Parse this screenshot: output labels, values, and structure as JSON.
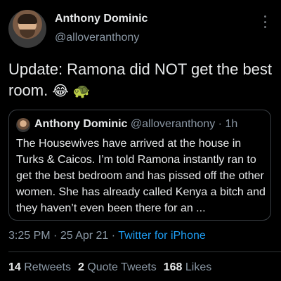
{
  "tweet": {
    "author_name": "Anthony Dominic",
    "author_handle": "@alloveranthony",
    "text": "Update: Ramona did NOT get the best room.",
    "emoji_1": "😂",
    "emoji_2": "🐢",
    "quote": {
      "author_name": "Anthony Dominic",
      "author_handle": "@alloveranthony",
      "separator": "·",
      "time": "1h",
      "text": "The Housewives have arrived at the house in Turks & Caicos. I’m told Ramona instantly ran to get the best bedroom and has pissed off the other women. She has already called Kenya a bitch and they haven’t even been there for an ..."
    },
    "time": "3:25 PM",
    "date_separator": "·",
    "date": "25 Apr 21",
    "source_separator": "·",
    "source": "Twitter for iPhone",
    "stats": {
      "retweets_count": "14",
      "retweets_label": "Retweets",
      "quote_tweets_count": "2",
      "quote_tweets_label": "Quote Tweets",
      "likes_count": "168",
      "likes_label": "Likes"
    }
  },
  "icons": {
    "more": "more-vertical-icon"
  },
  "colors": {
    "background": "#000000",
    "text": "#e7e9ea",
    "secondary_text": "#8b98a5",
    "link": "#1d9bf0",
    "border": "#3a3f44"
  }
}
